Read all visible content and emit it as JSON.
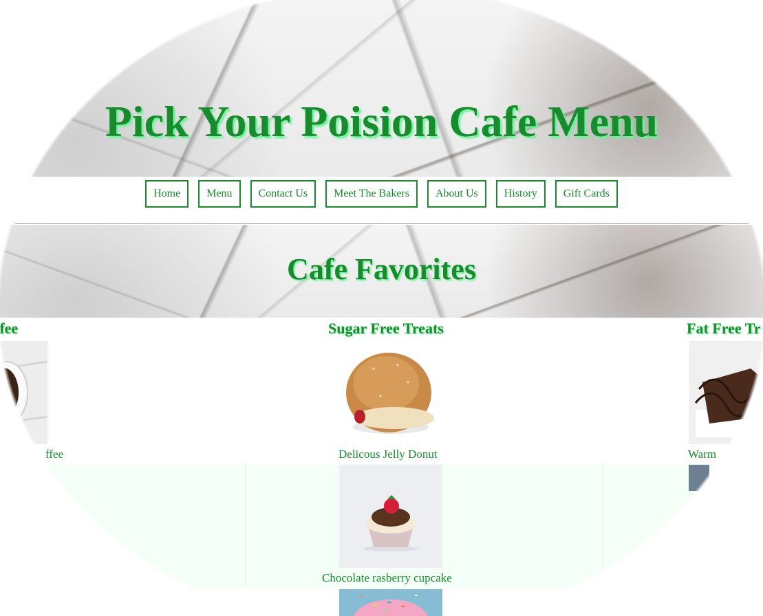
{
  "site": {
    "title": "Pick Your Poision Cafe Menu"
  },
  "nav": {
    "items": [
      "Home",
      "Menu",
      "Contact Us",
      "Meet The Bakers",
      "About Us",
      "History",
      "Gift Cards"
    ]
  },
  "favorites": {
    "heading": "Cafe Favorites",
    "columns": [
      {
        "heading": "ffee",
        "caption": "ffee"
      },
      {
        "heading": "Sugar Free Treats",
        "caption": "Delicous Jelly Donut",
        "second_caption": "Chocolate rasberry cupcake"
      },
      {
        "heading": "Fat Free Tr",
        "caption": "Warm"
      }
    ]
  },
  "colors": {
    "accent": "#1a8a2e",
    "shadow": "#6cf59a",
    "mint": "#f4fff7"
  },
  "icons": {
    "coffee": "coffee-photo",
    "donut": "jelly-donut-photo",
    "cupcake": "cupcake-photo",
    "brownie": "brownie-photo",
    "sprinkles": "sprinkle-donut-photo"
  }
}
